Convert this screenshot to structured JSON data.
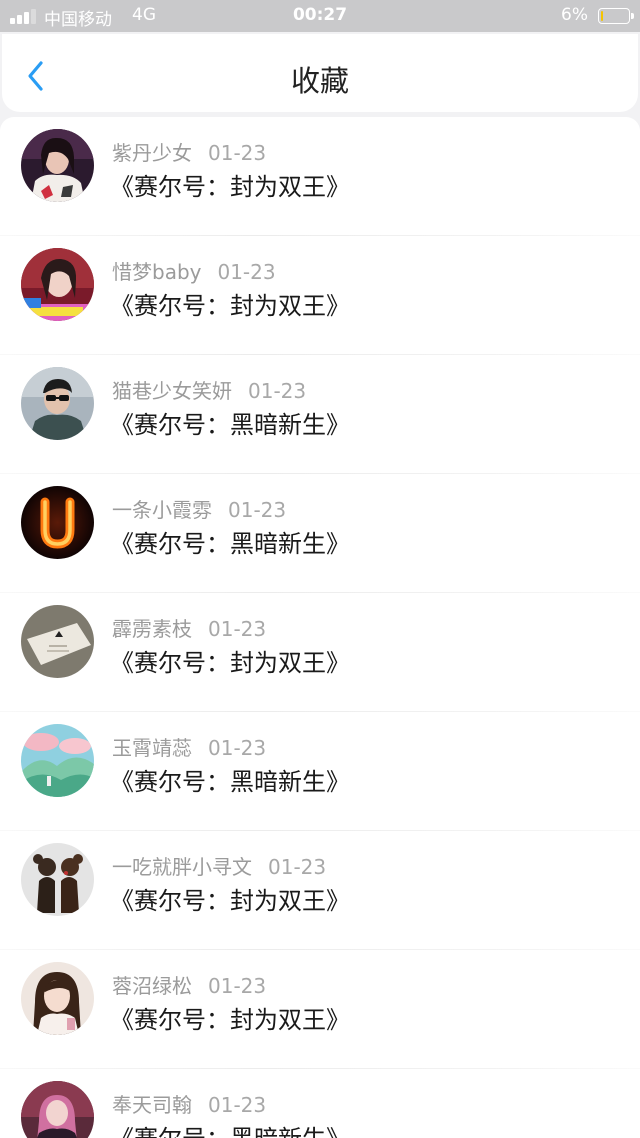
{
  "status_bar": {
    "carrier": "中国移动",
    "network": "4G",
    "time": "00:27",
    "battery": "6%",
    "signal_bars": 3,
    "battery_level": 0.06,
    "battery_color": "#f5c400"
  },
  "nav": {
    "title": "收藏",
    "back_icon": "chevron-left-icon",
    "accent_color": "#2a9df4"
  },
  "items": [
    {
      "author": "紫丹少女",
      "date": "01-23",
      "title": "《赛尔号：封为双王》"
    },
    {
      "author": "惜梦baby",
      "date": "01-23",
      "title": "《赛尔号：封为双王》"
    },
    {
      "author": "猫巷少女笑妍",
      "date": "01-23",
      "title": "《赛尔号：黑暗新生》"
    },
    {
      "author": "一条小霞雰",
      "date": "01-23",
      "title": "《赛尔号：黑暗新生》"
    },
    {
      "author": "霹雳素枝",
      "date": "01-23",
      "title": "《赛尔号：封为双王》"
    },
    {
      "author": "玉霄靖蕊",
      "date": "01-23",
      "title": "《赛尔号：黑暗新生》"
    },
    {
      "author": "一吃就胖小寻文",
      "date": "01-23",
      "title": "《赛尔号：封为双王》"
    },
    {
      "author": "蓉沼绿松",
      "date": "01-23",
      "title": "《赛尔号：封为双王》"
    },
    {
      "author": "奉天司翰",
      "date": "01-23",
      "title": "《赛尔号：黑暗新生》"
    }
  ]
}
